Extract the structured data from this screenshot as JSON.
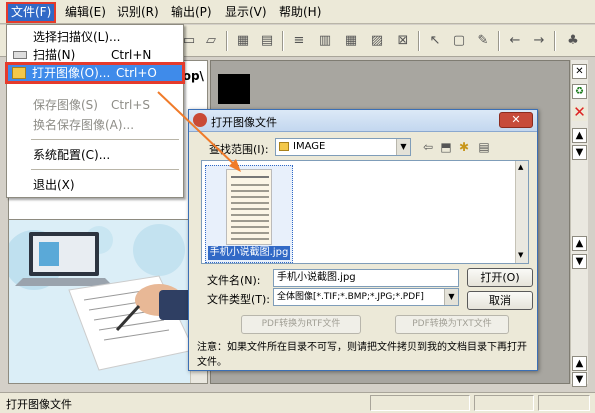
{
  "menubar": {
    "items": [
      "文件(F)",
      "编辑(E)",
      "识别(R)",
      "输出(P)",
      "显示(V)",
      "帮助(H)"
    ]
  },
  "file_menu": {
    "items": [
      {
        "label": "选择扫描仪(L)...",
        "shortcut": ""
      },
      {
        "label": "扫描(N)",
        "shortcut": "Ctrl+N"
      },
      {
        "label": "打开图像(O)...",
        "shortcut": "Ctrl+O"
      },
      {
        "label": "保存图像(S)",
        "shortcut": "Ctrl+S"
      },
      {
        "label": "换名保存图像(A)...",
        "shortcut": ""
      },
      {
        "label": "系统配置(C)...",
        "shortcut": ""
      },
      {
        "label": "退出(X)",
        "shortcut": ""
      }
    ]
  },
  "left_panel": {
    "partial_text": "ktop\\"
  },
  "dialog": {
    "title": "打开图像文件",
    "close_label": "✕",
    "look_in_label": "查找范围(I):",
    "look_in_value": "IMAGE",
    "file": {
      "name": "手机小说截图.jpg"
    },
    "filename_label": "文件名(N):",
    "filename_value": "手机小说截图.jpg",
    "filetype_label": "文件类型(T):",
    "filetype_value": "全体图像[*.TIF;*.BMP;*.JPG;*.PDF]",
    "open_button": "打开(O)",
    "cancel_button": "取消",
    "pdf_rtf_button": "PDF转换为RTF文件",
    "pdf_txt_button": "PDF转换为TXT文件",
    "note": "注意：如果文件所在目录不可写，则请把文件拷贝到我的文档目录下再打开文件。"
  },
  "statusbar": {
    "text": "打开图像文件"
  },
  "colors": {
    "highlight": "#3f8bea",
    "callout_border": "#e53b2c",
    "arrow": "#f07b2a"
  }
}
